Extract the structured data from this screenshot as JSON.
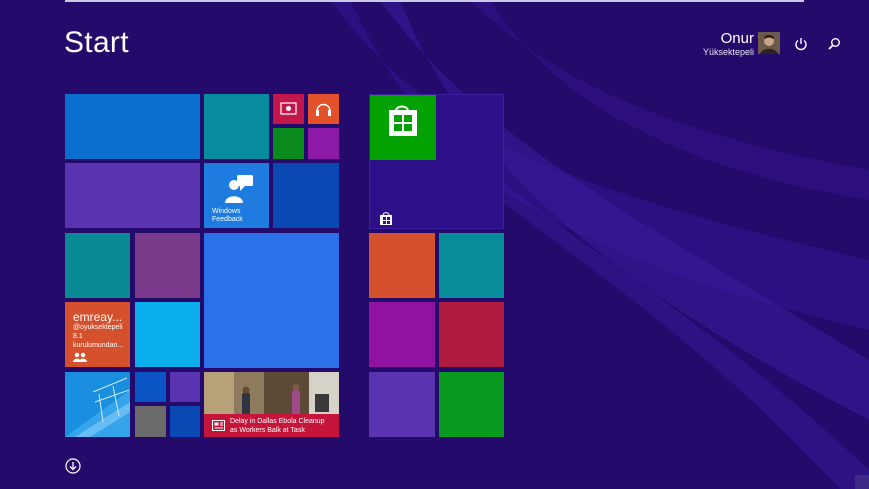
{
  "screen": {
    "title": "Start",
    "user": {
      "first_name": "Onur",
      "last_name": "Yüksektepeli"
    }
  },
  "icons": {
    "power": "power-icon",
    "search": "search-icon",
    "all_apps": "arrow-down-circle-icon"
  },
  "tiles": {
    "windows_feedback": {
      "label_line1": "Windows",
      "label_line2": "Feedback"
    },
    "people": {
      "name": "emreay...",
      "line1": "@oyuksektepeli",
      "line2": "8.1",
      "line3": "kurulumundan..."
    },
    "news": {
      "line1": "Delay in Dallas Ebola Cleanup",
      "line2": "as Workers Balk at Task"
    }
  },
  "colors": {
    "background": "#240a6b",
    "store_green": "#02a202",
    "news_red": "#c6153b",
    "people_orange": "#d5512d"
  }
}
